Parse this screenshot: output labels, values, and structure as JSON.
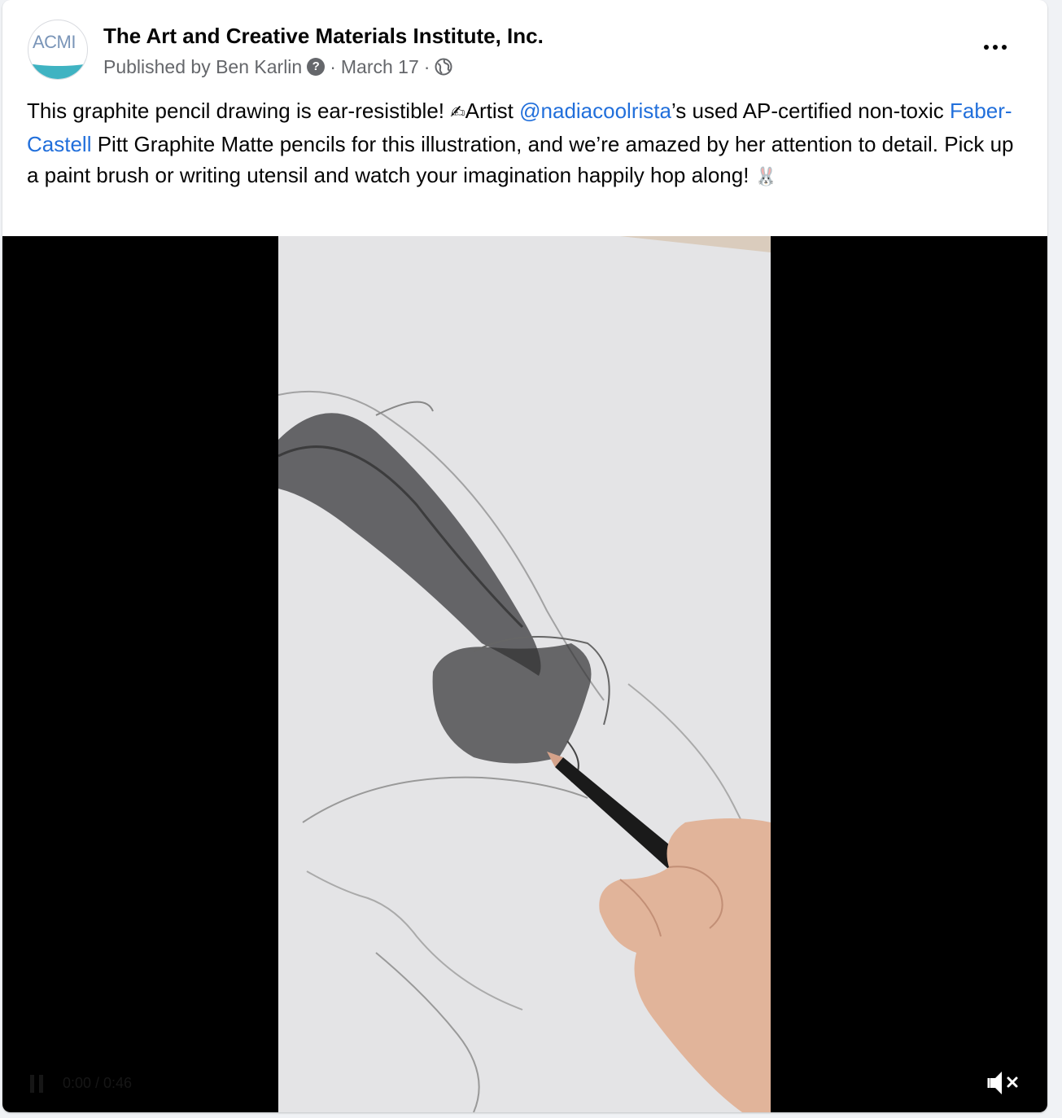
{
  "post": {
    "page_name": "The Art and Creative Materials Institute, Inc.",
    "avatar_text": "ACMI",
    "published_by": "Published by Ben Karlin",
    "separator": "·",
    "date": "March 17",
    "separator2": "·",
    "icons": {
      "help": "help-circle-icon",
      "audience": "globe-icon",
      "more": "more-options-icon"
    },
    "text": {
      "part1": "This graphite pencil drawing is ear-resistible! ",
      "emoji_pencil": "✍",
      "part2": "Artist ",
      "mention": "@nadiacoolrista",
      "part3": "’s used AP-certified non-toxic ",
      "brand_link": "Faber-Castell",
      "part4": " Pitt Graphite Matte pencils for this illustration, and we’re amazed by her attention to detail. Pick up a paint brush or writing utensil and watch your imagination happily hop along! ",
      "emoji_rabbit": "🐰"
    },
    "link_color": "#216fdb"
  },
  "video": {
    "description_visual": "pencil-drawing-video",
    "mute_icon": "speaker-muted-icon",
    "play_icon": "pause-icon",
    "time_text": "0:00 / 0:46"
  }
}
